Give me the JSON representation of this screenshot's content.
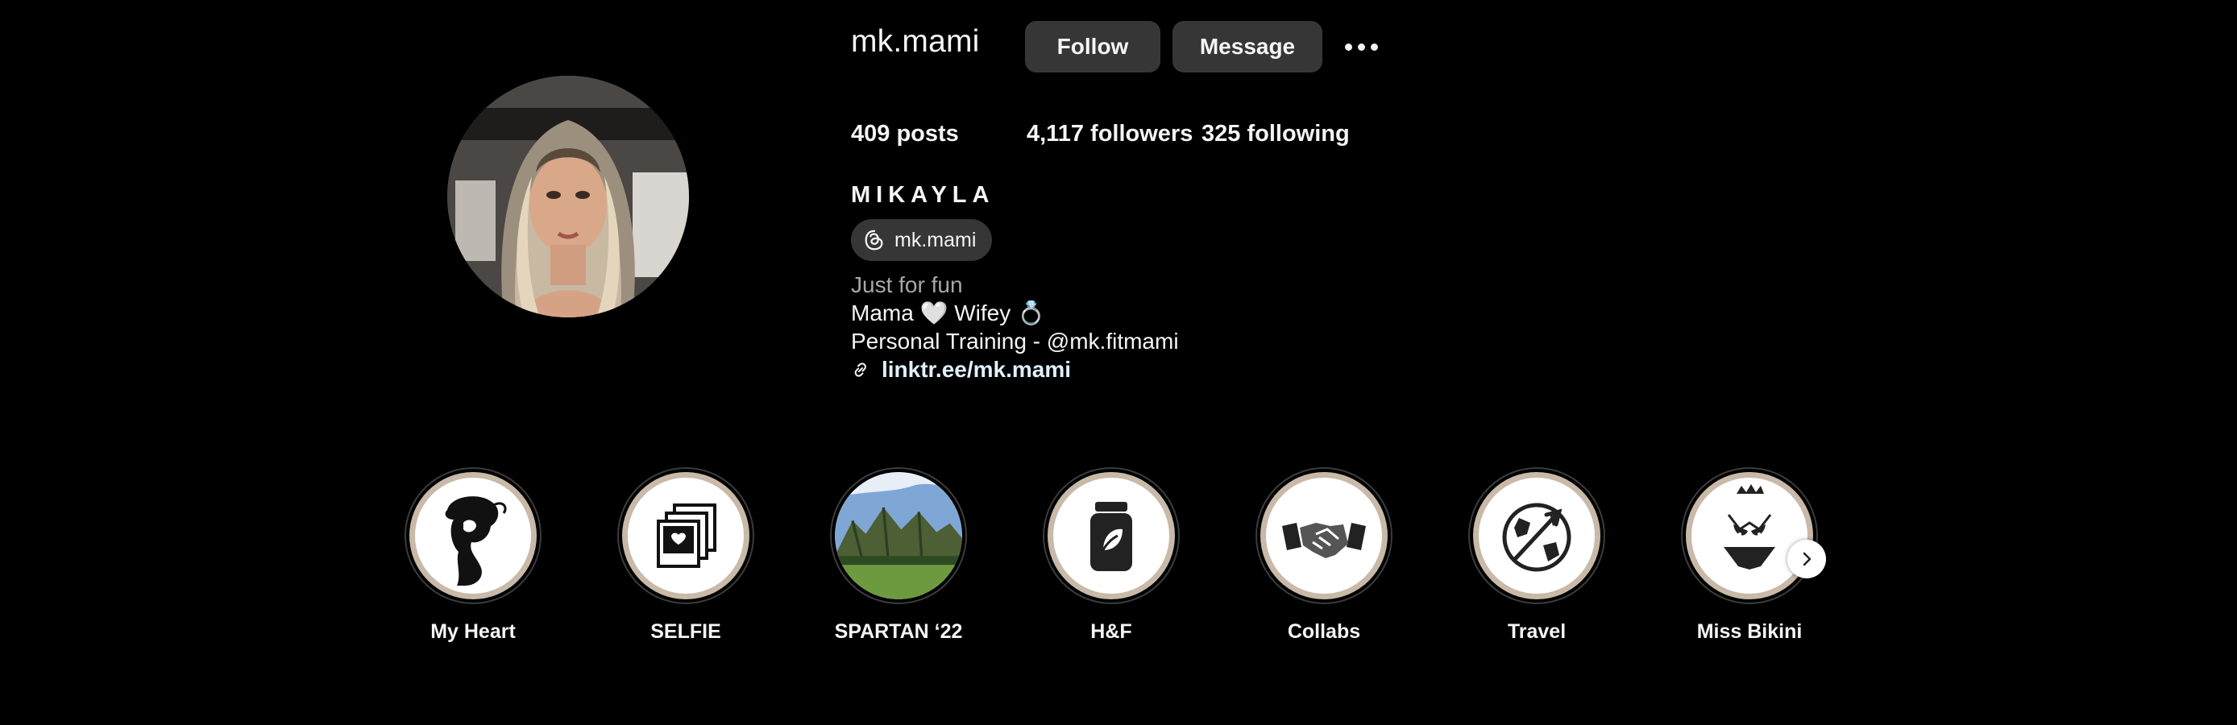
{
  "header": {
    "username": "mk.mami",
    "follow_label": "Follow",
    "message_label": "Message",
    "more_icon": "more-horizontal-icon"
  },
  "stats": {
    "posts_count": "409",
    "posts_label": "posts",
    "followers_count": "4,117",
    "followers_label": "followers",
    "following_count": "325",
    "following_label": "following"
  },
  "bio": {
    "full_name": "MIKAYLA",
    "threads_handle": "mk.mami",
    "category": "Just for fun",
    "line1": "Mama 🤍 Wifey 💍",
    "line2": "Personal Training - @mk.fitmami",
    "link": "linktr.ee/mk.mami"
  },
  "highlights": [
    {
      "label": "My Heart",
      "icon": "woman-silhouette-icon"
    },
    {
      "label": "SELFIE",
      "icon": "polaroid-stack-icon"
    },
    {
      "label": "SPARTAN ‘22",
      "icon": "mountain-photo"
    },
    {
      "label": "H&F",
      "icon": "supplement-jar-icon"
    },
    {
      "label": "Collabs",
      "icon": "handshake-icon"
    },
    {
      "label": "Travel",
      "icon": "globe-plane-icon"
    },
    {
      "label": "Miss Bikini",
      "icon": "bikini-tiara-icon"
    }
  ],
  "colors": {
    "background": "#000000",
    "button": "#363636",
    "text": "#f5f5f5",
    "muted_text": "#a8a8a8",
    "highlight_ring_inner": "#c8b9a8"
  }
}
